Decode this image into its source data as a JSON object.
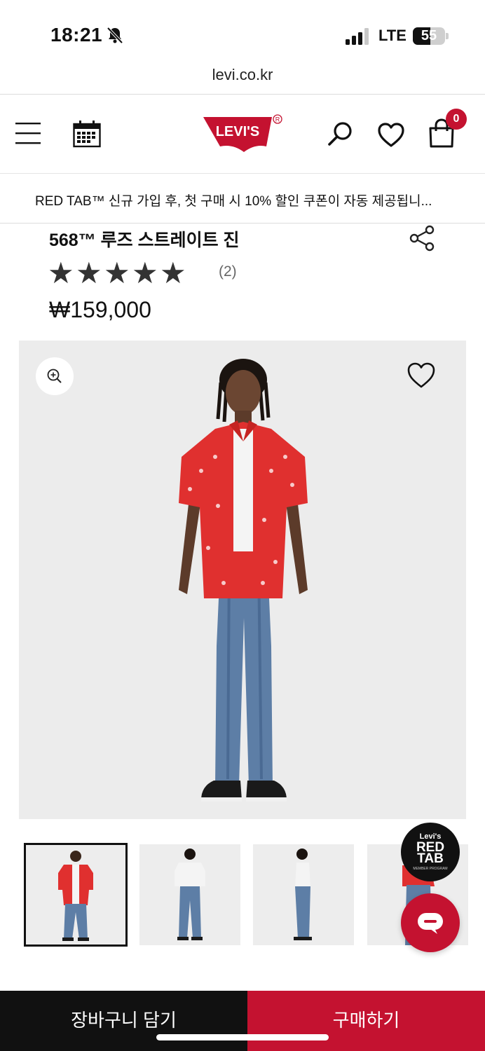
{
  "status_bar": {
    "time": "18:21",
    "network": "LTE",
    "battery": "55",
    "battery_level": 0.55
  },
  "browser": {
    "url": "levi.co.kr"
  },
  "header": {
    "brand": "Levi's",
    "cart_count": "0"
  },
  "promo": {
    "text": "RED TAB™ 신규 가입 후, 첫 구매 시 10% 할인 쿠폰이 자동 제공됩니..."
  },
  "product": {
    "title": "568™ 루즈 스트레이트 진",
    "rating": 5,
    "stars": "★★★★★",
    "review_count": "(2)",
    "price": "₩159,000"
  },
  "colors": {
    "accent": "#c41230",
    "dark": "#111111",
    "image_bg": "#ececec"
  },
  "icons": [
    "bell-slash-icon",
    "signal-icon",
    "battery-icon",
    "menu-icon",
    "calendar-icon",
    "search-icon",
    "heart-icon",
    "shopping-bag-icon",
    "share-icon",
    "zoom-in-icon",
    "chat-icon"
  ],
  "redtab": {
    "brand": "Levi's",
    "line1": "RED",
    "line2": "TAB",
    "sub": "MEMBER PROGRAM"
  },
  "actions": {
    "add_to_cart": "장바구니 담기",
    "buy_now": "구매하기"
  }
}
